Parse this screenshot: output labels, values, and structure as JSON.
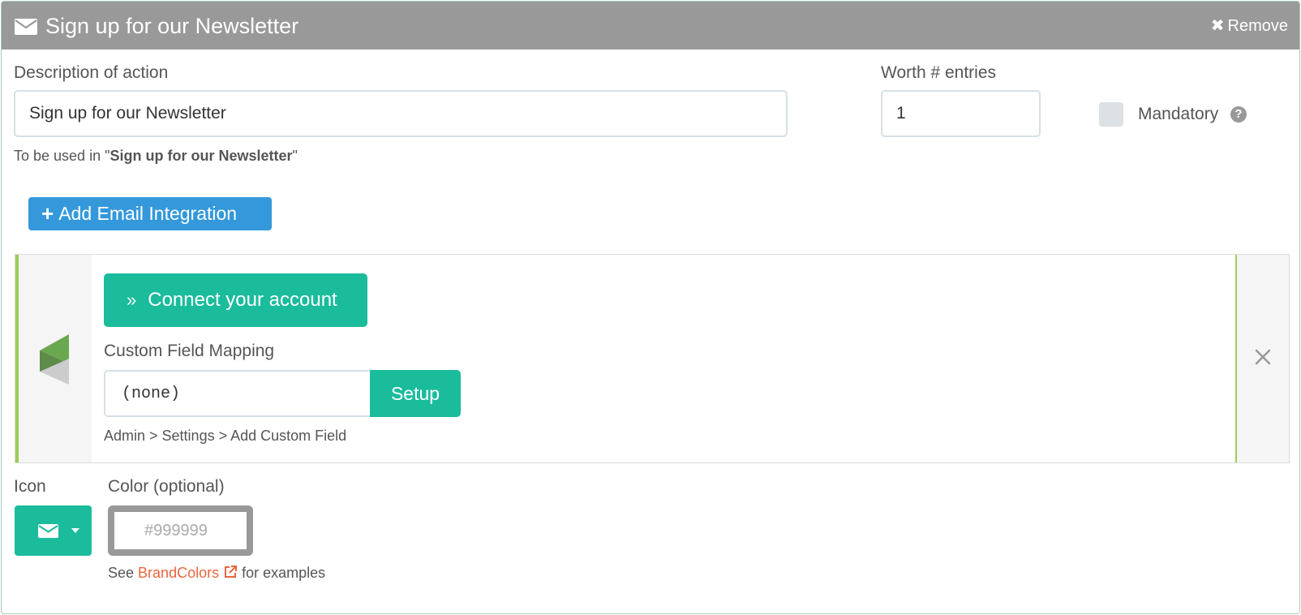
{
  "header": {
    "title": "Sign up for our Newsletter",
    "remove_label": "Remove"
  },
  "form": {
    "description_label": "Description of action",
    "description_value": "Sign up for our Newsletter",
    "usage_prefix": "To be used in \"",
    "usage_name": "Sign up for our Newsletter",
    "usage_suffix": "\"",
    "worth_label": "Worth # entries",
    "worth_value": "1",
    "mandatory_label": "Mandatory",
    "help_glyph": "?"
  },
  "add_integration_label": "Add Email Integration",
  "integration": {
    "connect_label": "Connect your account",
    "custom_field_label": "Custom Field Mapping",
    "custom_field_value": "(none)",
    "setup_label": "Setup",
    "admin_path": "Admin > Settings > Add Custom Field",
    "accent_color": "#9ccc56"
  },
  "icon_section": {
    "label": "Icon"
  },
  "color_section": {
    "label": "Color (optional)",
    "placeholder": "#999999",
    "see_prefix": "See",
    "link_text": "BrandColors",
    "see_suffix": "for examples"
  },
  "colors": {
    "header_bg": "#999999",
    "primary": "#3498db",
    "success": "#1abc9c",
    "link": "#e8663e"
  }
}
